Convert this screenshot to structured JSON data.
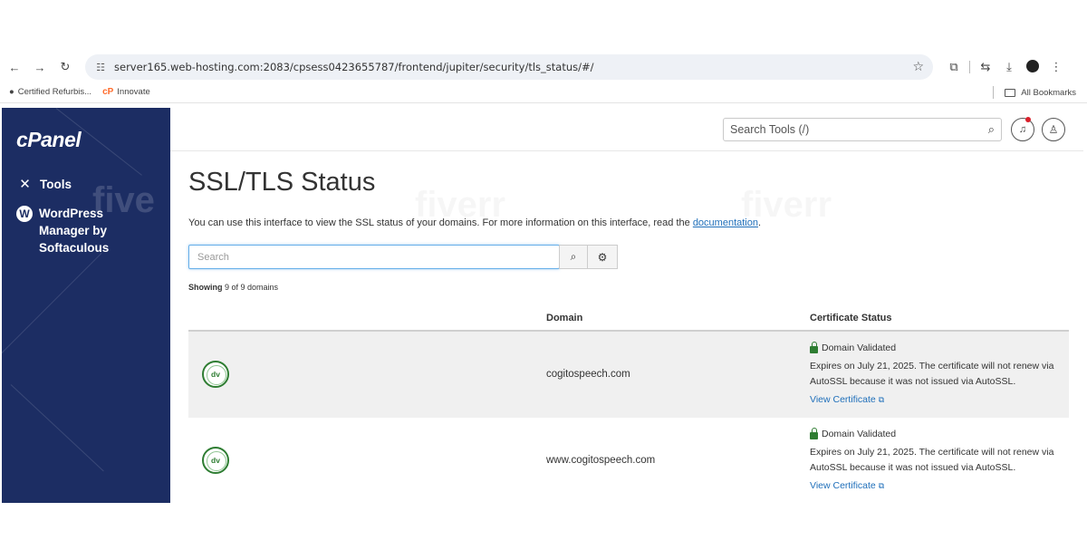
{
  "browser": {
    "url": "server165.web-hosting.com:2083/cpsess0423655787/frontend/jupiter/security/tls_status/#/",
    "bookmarks": [
      {
        "label": "Certified Refurbis..."
      },
      {
        "label": "Innovate",
        "icon_text": "cP"
      }
    ],
    "all_bookmarks": "All Bookmarks"
  },
  "sidebar": {
    "logo": "cPanel",
    "items": [
      {
        "label": "Tools"
      },
      {
        "label": "WordPress\nManager by\nSoftaculous"
      }
    ]
  },
  "header": {
    "search_placeholder": "Search Tools (/)"
  },
  "page": {
    "title": "SSL/TLS Status",
    "intro_text": "You can use this interface to view the SSL status of your domains. For more information on this interface, read the ",
    "intro_link": "documentation",
    "intro_end": ".",
    "search_placeholder": "Search",
    "showing_prefix": "Showing",
    "showing_rest": "9 of 9 domains",
    "columns": {
      "domain": "Domain",
      "cert": "Certificate Status"
    }
  },
  "rows": [
    {
      "badge": "dv",
      "domain": "cogitospeech.com",
      "status": "Domain Validated",
      "expiry": "Expires on July 21, 2025. The certificate will not renew via AutoSSL because it was not issued via AutoSSL.",
      "view": "View Certificate"
    },
    {
      "badge": "dv",
      "domain": "www.cogitospeech.com",
      "status": "Domain Validated",
      "expiry": "Expires on July 21, 2025. The certificate will not renew via AutoSSL because it was not issued via AutoSSL.",
      "view": "View Certificate"
    }
  ],
  "colors": {
    "sidebar_bg": "#1c2d63",
    "link": "#1f6fba",
    "validated_green": "#2e7d32"
  }
}
